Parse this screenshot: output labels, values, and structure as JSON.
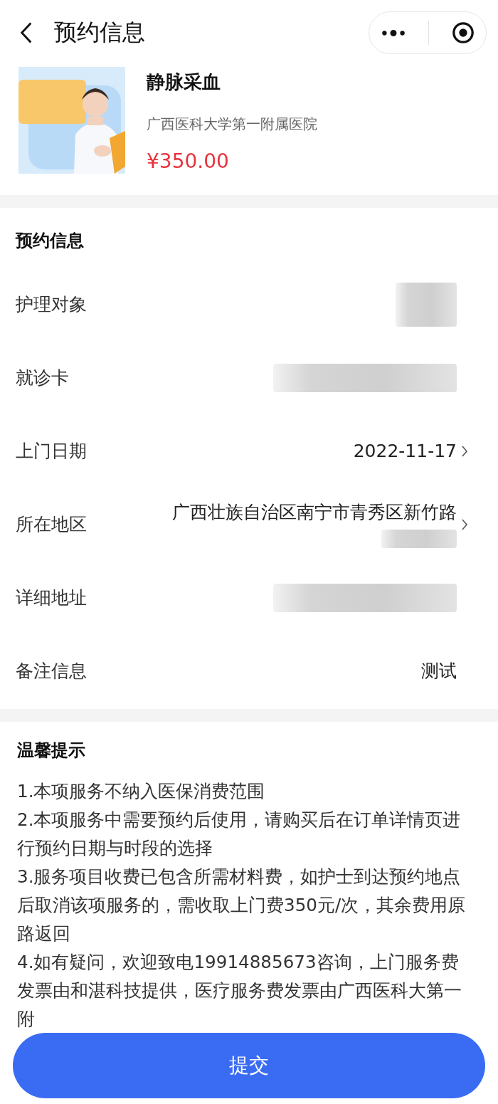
{
  "nav": {
    "title": "预约信息"
  },
  "product": {
    "kind": "picture",
    "name": "静脉采血",
    "hospital": "广西医科大学第一附属医院",
    "price": "¥350.00"
  },
  "booking": {
    "title": "预约信息",
    "rows": [
      {
        "label": "护理对象",
        "kind": "redacted",
        "chevron": false
      },
      {
        "label": "就诊卡",
        "kind": "redacted",
        "chevron": false
      },
      {
        "label": "上门日期",
        "kind": "text",
        "value": "2022-11-17",
        "chevron": true
      },
      {
        "label": "所在地区",
        "kind": "text_redacted",
        "value": "广西壮族自治区南宁市青秀区新竹路",
        "chevron": true
      },
      {
        "label": "详细地址",
        "kind": "redacted",
        "chevron": false
      },
      {
        "label": "备注信息",
        "kind": "text",
        "value": "测试",
        "chevron": false
      }
    ]
  },
  "tips": {
    "title": "温馨提示",
    "items": [
      "1.本项服务不纳入医保消费范围",
      "2.本项服务中需要预约后使用，请购买后在订单详情页进行预约日期与时段的选择",
      "3.服务项目收费已包含所需材料费，如护士到达预约地点后取消该项服务的，需收取上门费350元/次，其余费用原路返回",
      "4.如有疑问，欢迎致电19914885673咨询，上门服务费发票由和湛科技提供，医疗服务费发票由广西医科大第一附"
    ]
  },
  "submit": {
    "label": "提交"
  }
}
